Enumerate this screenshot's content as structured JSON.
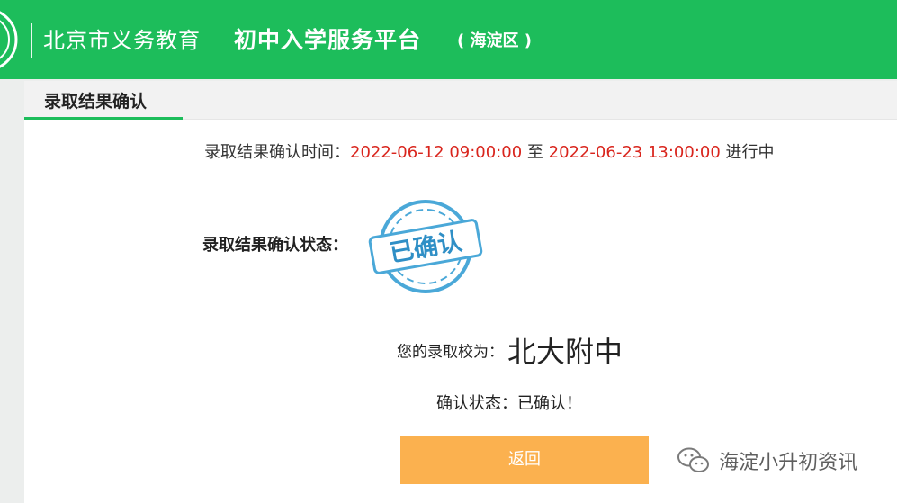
{
  "header": {
    "title_part1": "北京市义务教育",
    "title_part2": "初中入学服务平台",
    "title_part3": "( 海淀区 )",
    "bg_color": "#1dbd5b"
  },
  "tab": {
    "label": "录取结果确认"
  },
  "confirm_time": {
    "label": "录取结果确认时间：",
    "start": "2022-06-12 09:00:00",
    "separator": " 至 ",
    "end": "2022-06-23 13:00:00",
    "suffix": " 进行中"
  },
  "status": {
    "label": "录取结果确认状态：",
    "stamp_text": "已确认"
  },
  "school": {
    "label": "您的录取校为：",
    "name": "北大附中"
  },
  "confirm_state": {
    "label": "确认状态：",
    "value": "已确认！"
  },
  "back_button": {
    "label": "返回",
    "color": "#fbb14f"
  },
  "watermark": {
    "text": "海淀小升初资讯"
  },
  "icons": {
    "logo": "school-emblem-icon",
    "stamp": "confirmed-stamp-icon",
    "watermark": "wechat-icon"
  }
}
